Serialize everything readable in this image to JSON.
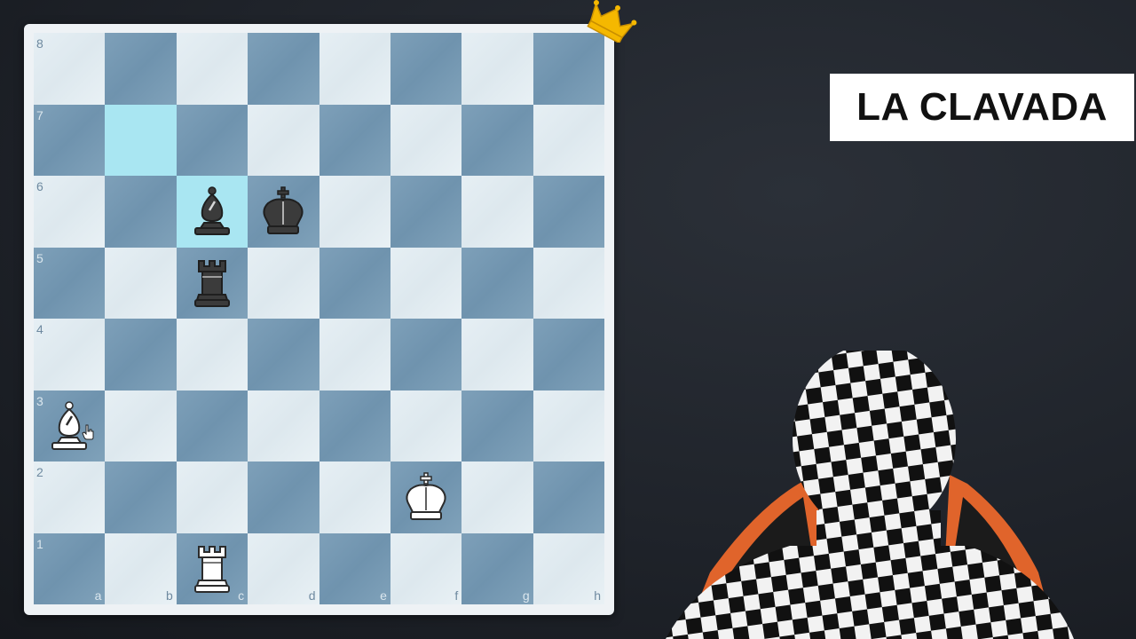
{
  "title": "LA CLAVADA",
  "board": {
    "files": [
      "a",
      "b",
      "c",
      "d",
      "e",
      "f",
      "g",
      "h"
    ],
    "ranks": [
      "8",
      "7",
      "6",
      "5",
      "4",
      "3",
      "2",
      "1"
    ],
    "highlighted_squares": [
      "b7",
      "c6"
    ],
    "pieces": [
      {
        "square": "c6",
        "piece": "black-bishop"
      },
      {
        "square": "d6",
        "piece": "black-king"
      },
      {
        "square": "c5",
        "piece": "black-rook"
      },
      {
        "square": "a3",
        "piece": "white-bishop"
      },
      {
        "square": "f2",
        "piece": "white-king"
      },
      {
        "square": "c1",
        "piece": "white-rook"
      }
    ]
  },
  "icons": {
    "crown": "crown-icon",
    "cursor": "hand-cursor-icon"
  },
  "colors": {
    "light_square": "#e6eff4",
    "dark_square": "#7ea0b9",
    "highlight": "#a9e6f2",
    "crown": "#f5b800",
    "background": "#1f232a"
  }
}
